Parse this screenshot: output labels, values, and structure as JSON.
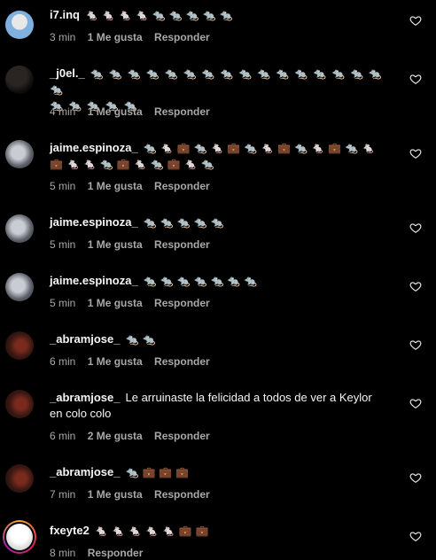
{
  "comments": [
    {
      "username": "i7.inq",
      "text": "🐁🐁🐁🐁🐀🐀🐀🐀🐀",
      "time": "3 min",
      "likes": "1 Me gusta",
      "reply": "Responder",
      "avatar": "user-photo"
    },
    {
      "username": "_j0el._",
      "text": "🐀🐀🐀🐀🐀🐀🐀🐀🐀🐀🐀🐀🐀🐀🐀🐀🐀",
      "text2": "🐀🐀🐀🐀🐀",
      "time": "4 min",
      "likes": "1 Me gusta",
      "reply": "Responder",
      "avatar": "dark-photo"
    },
    {
      "username": "jaime.espinoza_",
      "text": "🐀🐁💼🐀🐁💼🐀🐁💼🐀🐁💼🐀🐁",
      "text2": "💼🐁🐁🐀💼🐁🐀💼🐁🐀",
      "time": "5 min",
      "likes": "1 Me gusta",
      "reply": "Responder",
      "avatar": "user-photo"
    },
    {
      "username": "jaime.espinoza_",
      "text": "🐀🐀🐀🐀🐀",
      "time": "5 min",
      "likes": "1 Me gusta",
      "reply": "Responder",
      "avatar": "user-photo"
    },
    {
      "username": "jaime.espinoza_",
      "text": "🐀🐀🐀🐀🐀🐀🐀",
      "time": "5 min",
      "likes": "1 Me gusta",
      "reply": "Responder",
      "avatar": "user-photo"
    },
    {
      "username": "_abramjose_",
      "text": "🐀🐀",
      "time": "6 min",
      "likes": "1 Me gusta",
      "reply": "Responder",
      "avatar": "user-photo"
    },
    {
      "username": "_abramjose_",
      "text": "Le arruinaste la felicidad a todos de ver a Keylor",
      "text2": "en colo colo",
      "time": "6 min",
      "likes": "2 Me gusta",
      "reply": "Responder",
      "avatar": "user-photo"
    },
    {
      "username": "_abramjose_",
      "text": "🐀💼💼💼",
      "time": "7 min",
      "likes": "1 Me gusta",
      "reply": "Responder",
      "avatar": "user-photo"
    },
    {
      "username": "fxeyte2",
      "text": "🐁🐁🐁🐁🐁💼💼",
      "time": "8 min",
      "reply": "Responder",
      "avatar": "user-photo-story-ring"
    }
  ],
  "icons": {
    "like": "heart-outline-icon"
  },
  "colors": {
    "background": "#000000",
    "text": "#f5f5f5",
    "secondary": "#a8a8a8"
  }
}
